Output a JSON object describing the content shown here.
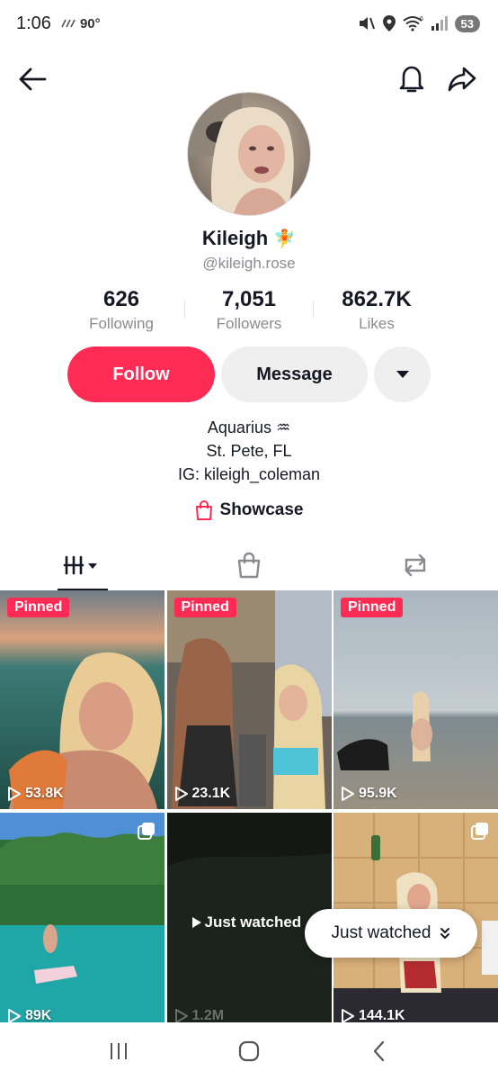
{
  "status_bar": {
    "time": "1:06",
    "temperature": "90°",
    "battery": "53",
    "wifi_badge": "6"
  },
  "profile": {
    "display_name": "Kileigh",
    "name_emoji": "🧚",
    "handle": "@kileigh.rose",
    "stats": [
      {
        "value": "626",
        "label": "Following"
      },
      {
        "value": "7,051",
        "label": "Followers"
      },
      {
        "value": "862.7K",
        "label": "Likes"
      }
    ],
    "bio": [
      "Aquarius ♒",
      "St. Pete, FL",
      "IG: kileigh_coleman"
    ],
    "showcase_label": "Showcase"
  },
  "actions": {
    "follow_label": "Follow",
    "message_label": "Message"
  },
  "videos": [
    {
      "badge": "Pinned",
      "views": "53.8K"
    },
    {
      "badge": "Pinned",
      "views": "23.1K"
    },
    {
      "badge": "Pinned",
      "views": "95.9K"
    },
    {
      "badge": "",
      "views": "89K"
    },
    {
      "badge": "",
      "views": "1.2M",
      "overlay": "Just watched"
    },
    {
      "badge": "",
      "views": "144.1K"
    }
  ],
  "toast": {
    "label": "Just watched"
  },
  "colors": {
    "accent": "#fe2c55",
    "secondary_button": "#efeff0",
    "muted_text": "#8a8b91"
  }
}
